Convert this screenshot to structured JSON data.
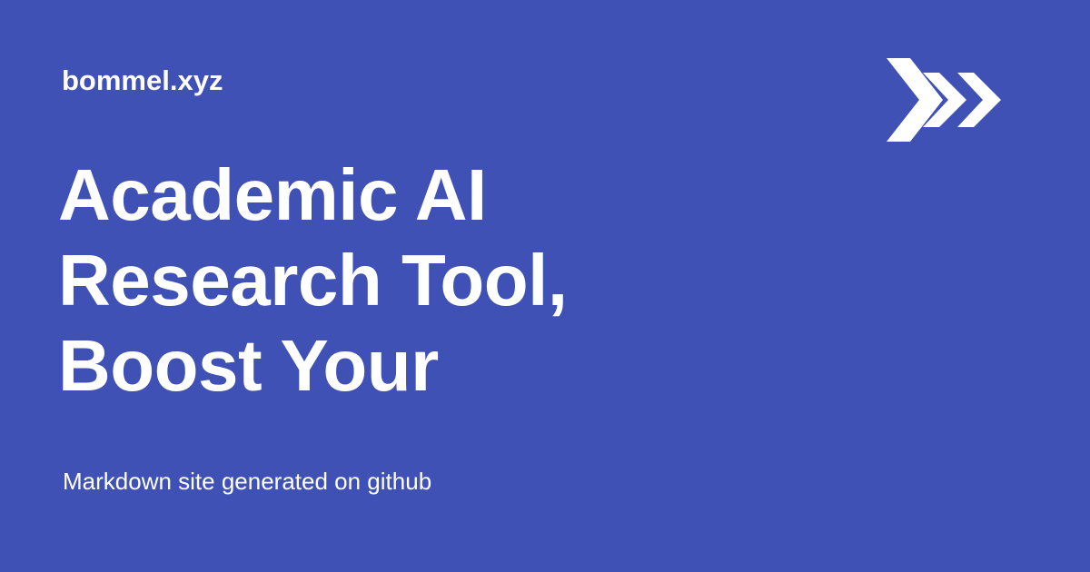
{
  "site": {
    "name": "bommel.xyz"
  },
  "headline": {
    "lines": [
      "Academic AI",
      "Research Tool,",
      "Boost Your"
    ]
  },
  "subtitle": "Markdown site generated on github",
  "logo": {
    "icon": "triple-chevron-right-icon"
  },
  "colors": {
    "background": "#3f51b5",
    "text": "#ffffff"
  }
}
